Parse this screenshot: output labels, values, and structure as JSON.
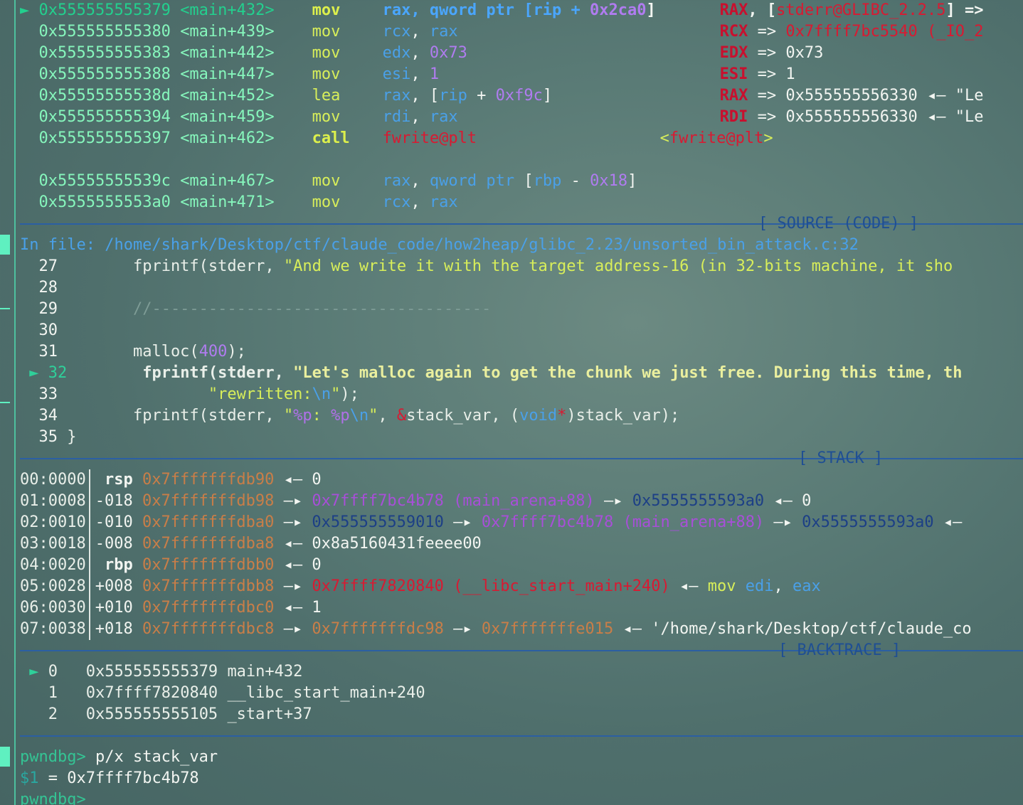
{
  "disasm": [
    {
      "marker": "►",
      "addr": "0x555555555379",
      "sym": "<main+432>",
      "op": "mov",
      "operands": "rax, qword ptr [rip + 0x2ca0]",
      "comment": "RAX, [stderr@GLIBC_2.2.5] =>",
      "current": true
    },
    {
      "marker": " ",
      "addr": "0x555555555380",
      "sym": "<main+439>",
      "op": "mov",
      "operands": "rcx, rax",
      "comment": "RCX => 0x7ffff7bc5540 (_IO_2"
    },
    {
      "marker": " ",
      "addr": "0x555555555383",
      "sym": "<main+442>",
      "op": "mov",
      "operands": "edx, 0x73",
      "comment": "EDX => 0x73"
    },
    {
      "marker": " ",
      "addr": "0x555555555388",
      "sym": "<main+447>",
      "op": "mov",
      "operands": "esi, 1",
      "comment": "ESI => 1"
    },
    {
      "marker": " ",
      "addr": "0x55555555538d",
      "sym": "<main+452>",
      "op": "lea",
      "operands": "rax, [rip + 0xf9c]",
      "comment": "RAX => 0x555555556330 ◂— \"Le"
    },
    {
      "marker": " ",
      "addr": "0x555555555394",
      "sym": "<main+459>",
      "op": "mov",
      "operands": "rdi, rax",
      "comment": "RDI => 0x555555556330 ◂— \"Le"
    },
    {
      "marker": " ",
      "addr": "0x555555555397",
      "sym": "<main+462>",
      "op": "call",
      "operands": "fwrite@plt",
      "comment": "<fwrite@plt>"
    },
    {
      "marker": " ",
      "addr": "0x55555555539c",
      "sym": "<main+467>",
      "op": "mov",
      "operands": "rax, qword ptr [rbp - 0x18]",
      "comment": ""
    },
    {
      "marker": " ",
      "addr": "0x5555555553a0",
      "sym": "<main+471>",
      "op": "mov",
      "operands": "rcx, rax",
      "comment": ""
    }
  ],
  "headers": {
    "source": "[ SOURCE (CODE) ]",
    "stack": "[ STACK ]",
    "backtrace": "[ BACKTRACE ]"
  },
  "source": {
    "file_label": "In file: /home/shark/Desktop/ctf/claude_code/how2heap/glibc_2.23/unsorted_bin_attack.c:32",
    "lines": [
      {
        "num": "27",
        "text": "        fprintf(stderr, \"And we write it with the target address-16 (in 32-bits machine, it sho"
      },
      {
        "num": "28",
        "text": ""
      },
      {
        "num": "29",
        "text": "        //------------------------------------"
      },
      {
        "num": "30",
        "text": ""
      },
      {
        "num": "31",
        "text": "        malloc(400);"
      },
      {
        "num": "32",
        "text": "        fprintf(stderr, \"Let's malloc again to get the chunk we just free. During this time, th",
        "current": true
      },
      {
        "num": "33",
        "text": "                \"rewritten:\\n\");"
      },
      {
        "num": "34",
        "text": "        fprintf(stderr, \"%p: %p\\n\", &stack_var, (void*)stack_var);"
      },
      {
        "num": "35",
        "text": "}"
      }
    ]
  },
  "stack": [
    {
      "idx": "00:0000",
      "reg": "rsp",
      "addr": "0x7fffffffdb90",
      "rest": "◂— 0"
    },
    {
      "idx": "01:0008",
      "reg": "-018",
      "addr": "0x7fffffffdb98",
      "rest": "—▸ 0x7ffff7bc4b78 (main_arena+88) —▸ 0x5555555593a0 ◂— 0"
    },
    {
      "idx": "02:0010",
      "reg": "-010",
      "addr": "0x7fffffffdba0",
      "rest": "—▸ 0x555555559010 —▸ 0x7ffff7bc4b78 (main_arena+88) —▸ 0x5555555593a0 ◂—"
    },
    {
      "idx": "03:0018",
      "reg": "-008",
      "addr": "0x7fffffffdba8",
      "rest": "◂— 0x8a5160431feeee00"
    },
    {
      "idx": "04:0020",
      "reg": "rbp",
      "addr": "0x7fffffffdbb0",
      "rest": "◂— 0"
    },
    {
      "idx": "05:0028",
      "reg": "+008",
      "addr": "0x7fffffffdbb8",
      "rest": "—▸ 0x7ffff7820840 (__libc_start_main+240) ◂— mov edi, eax"
    },
    {
      "idx": "06:0030",
      "reg": "+010",
      "addr": "0x7fffffffdbc0",
      "rest": "◂— 1"
    },
    {
      "idx": "07:0038",
      "reg": "+018",
      "addr": "0x7fffffffdbc8",
      "rest": "—▸ 0x7fffffffdc98 —▸ 0x7fffffffe015 ◂— '/home/shark/Desktop/ctf/claude_co"
    }
  ],
  "backtrace": [
    {
      "marker": "►",
      "num": "0",
      "addr": "0x555555555379",
      "sym": "main+432"
    },
    {
      "marker": " ",
      "num": "1",
      "addr": "0x7ffff7820840",
      "sym": "__libc_start_main+240"
    },
    {
      "marker": " ",
      "num": "2",
      "addr": "0x555555555105",
      "sym": "_start+37"
    }
  ],
  "console": {
    "prompt": "pwndbg>",
    "command": "p/x stack_var",
    "result_var": "$1",
    "result_eq": " = ",
    "result_val": "0x7ffff7bc4b78",
    "prompt2": "pwndbg>"
  }
}
